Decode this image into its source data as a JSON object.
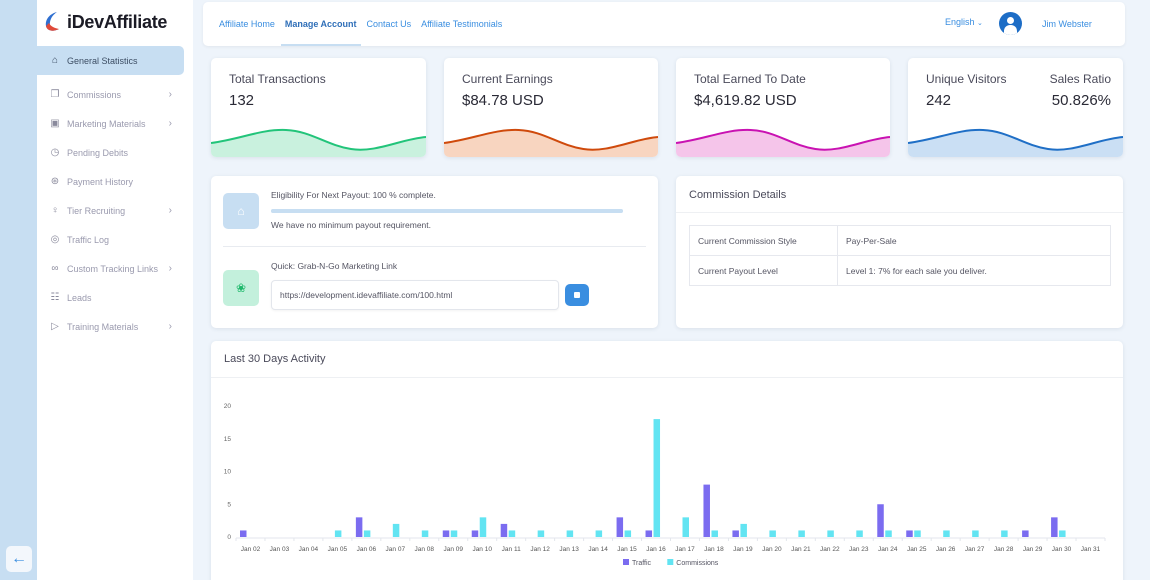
{
  "brand": {
    "name": "iDevAffiliate"
  },
  "sidebar": {
    "items": [
      {
        "label": "General Statistics",
        "icon": "home-icon",
        "active": true,
        "has_submenu": false
      },
      {
        "label": "Commissions",
        "icon": "copy-documents-icon",
        "active": false,
        "has_submenu": true
      },
      {
        "label": "Marketing Materials",
        "icon": "image-icon",
        "active": false,
        "has_submenu": true
      },
      {
        "label": "Pending Debits",
        "icon": "clock-icon",
        "active": false,
        "has_submenu": false
      },
      {
        "label": "Payment History",
        "icon": "dollar-circle-icon",
        "active": false,
        "has_submenu": false
      },
      {
        "label": "Tier Recruiting",
        "icon": "user-plus-icon",
        "active": false,
        "has_submenu": true
      },
      {
        "label": "Traffic Log",
        "icon": "target-icon",
        "active": false,
        "has_submenu": false
      },
      {
        "label": "Custom Tracking Links",
        "icon": "link-icon",
        "active": false,
        "has_submenu": true
      },
      {
        "label": "Leads",
        "icon": "document-icon",
        "active": false,
        "has_submenu": false
      },
      {
        "label": "Training Materials",
        "icon": "video-file-icon",
        "active": false,
        "has_submenu": true
      }
    ],
    "collapse_icon": "arrow-left-icon"
  },
  "topbar": {
    "nav": [
      {
        "label": "Affiliate Home",
        "active": false
      },
      {
        "label": "Manage Account",
        "active": true
      },
      {
        "label": "Contact Us",
        "active": false
      },
      {
        "label": "Affiliate Testimonials",
        "active": false
      }
    ],
    "language": "English",
    "user_name": "Jim Webster"
  },
  "stats": [
    {
      "label": "Total Transactions",
      "value": "132",
      "color": "#22c47a",
      "fill": "#c9f1de"
    },
    {
      "label": "Current Earnings",
      "value": "$84.78 USD",
      "color": "#cf4a0c",
      "fill": "#f8d5c0"
    },
    {
      "label": "Total Earned To Date",
      "value": "$4,619.82 USD",
      "color": "#c912b2",
      "fill": "#f5c5ea"
    },
    {
      "label": "Unique Visitors",
      "value": "242",
      "label2": "Sales Ratio",
      "value2": "50.826%",
      "color": "#1f6fc6",
      "fill": "#cadff4"
    }
  ],
  "payout": {
    "eligibility_text": "Eligibility For Next Payout: 100 % complete.",
    "progress_percent": 100,
    "note": "We have no minimum payout requirement.",
    "grab_label": "Quick: Grab-N-Go Marketing Link",
    "link_value": "https://development.idevaffiliate.com/100.html"
  },
  "commission_details": {
    "title": "Commission Details",
    "rows": [
      {
        "label": "Current Commission Style",
        "value": "Pay-Per-Sale"
      },
      {
        "label": "Current Payout Level",
        "value": "Level 1: 7% for each sale you deliver."
      }
    ]
  },
  "activity": {
    "title": "Last 30 Days Activity"
  },
  "chart_data": {
    "type": "bar",
    "title": "Last 30 Days Activity",
    "xlabel": "",
    "ylabel": "",
    "ylim": [
      0,
      20
    ],
    "yticks": [
      0,
      5,
      10,
      15,
      20
    ],
    "grid": false,
    "legend": "bottom-center",
    "categories": [
      "Jan 02",
      "Jan 03",
      "Jan 04",
      "Jan 05",
      "Jan 06",
      "Jan 07",
      "Jan 08",
      "Jan 09",
      "Jan 10",
      "Jan 11",
      "Jan 12",
      "Jan 13",
      "Jan 14",
      "Jan 15",
      "Jan 16",
      "Jan 17",
      "Jan 18",
      "Jan 19",
      "Jan 20",
      "Jan 21",
      "Jan 22",
      "Jan 23",
      "Jan 24",
      "Jan 25",
      "Jan 26",
      "Jan 27",
      "Jan 28",
      "Jan 29",
      "Jan 30",
      "Jan 31"
    ],
    "series": [
      {
        "name": "Traffic",
        "color": "#7b6cf0",
        "values": [
          1,
          0,
          0,
          0,
          3,
          0,
          0,
          1,
          1,
          2,
          0,
          0,
          0,
          3,
          1,
          0,
          8,
          1,
          0,
          0,
          0,
          0,
          5,
          1,
          0,
          0,
          0,
          1,
          3,
          0
        ]
      },
      {
        "name": "Commissions",
        "color": "#62e4f2",
        "values": [
          0,
          0,
          0,
          1,
          1,
          2,
          1,
          1,
          3,
          1,
          1,
          1,
          1,
          1,
          18,
          3,
          1,
          2,
          1,
          1,
          1,
          1,
          1,
          1,
          1,
          1,
          1,
          0,
          1,
          0
        ]
      }
    ]
  }
}
